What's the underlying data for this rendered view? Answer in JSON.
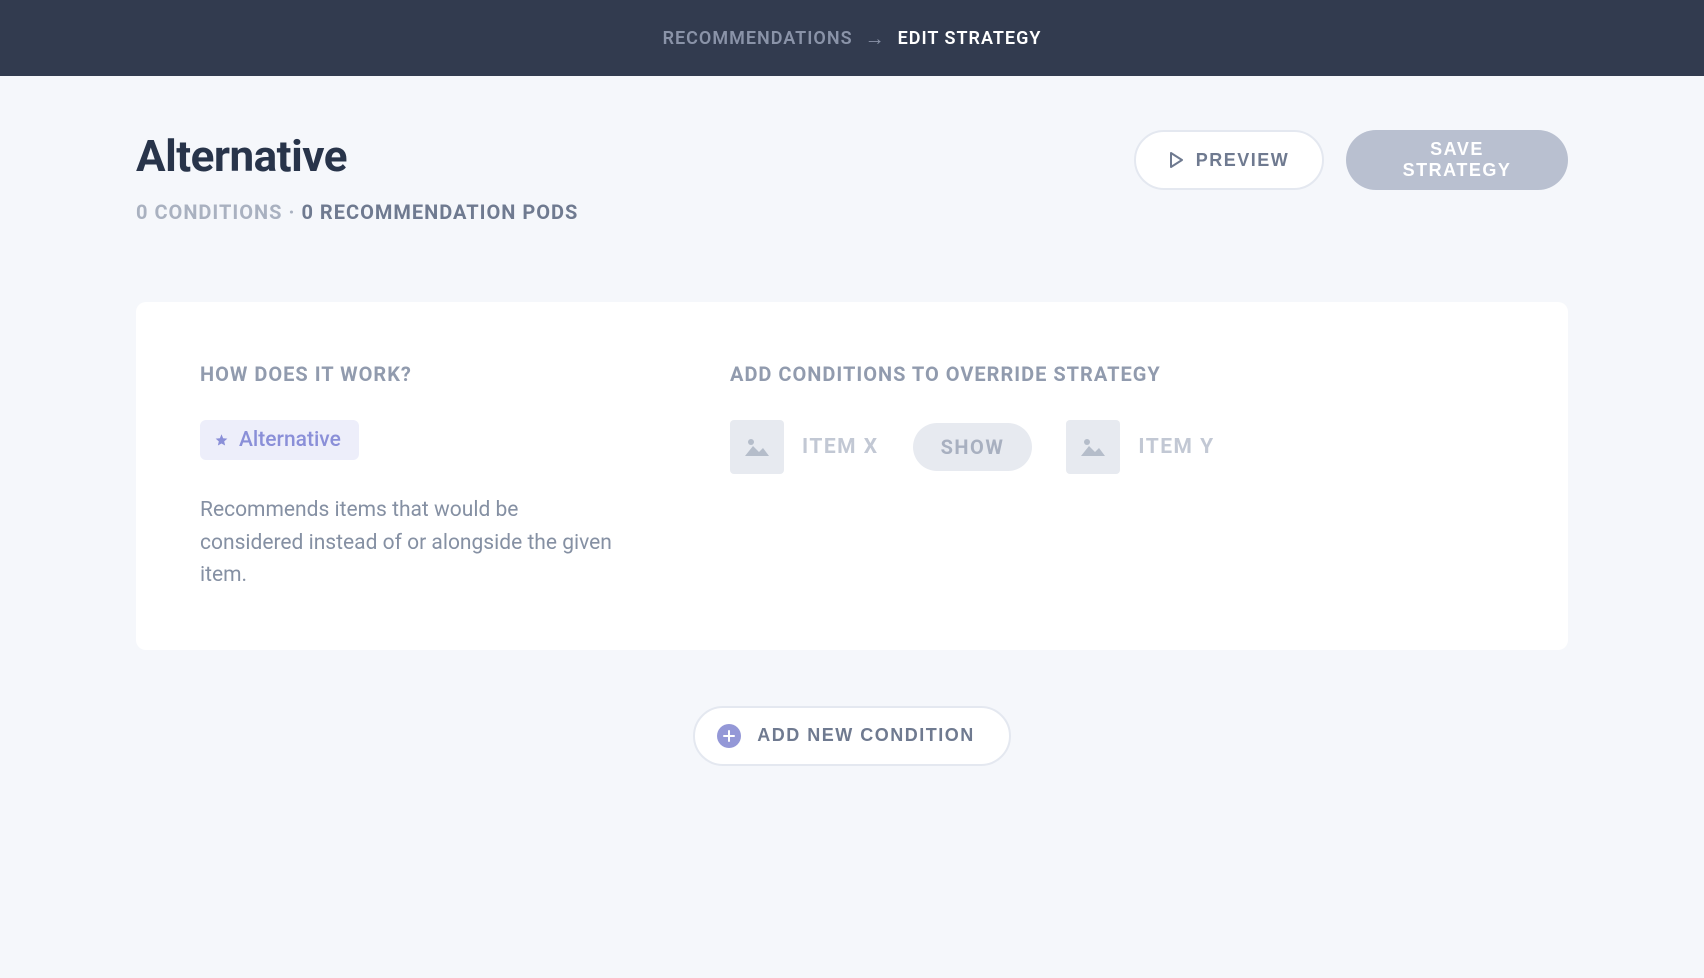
{
  "breadcrumb": {
    "parent": "Recommendations",
    "current": "Edit Strategy"
  },
  "title": "Alternative",
  "subtitle": {
    "conditions": "0 Conditions",
    "separator": "·",
    "pods": "0 Recommendation Pods"
  },
  "actions": {
    "preview": "Preview",
    "save": "Save Strategy"
  },
  "how_it_works": {
    "heading": "How does it work?",
    "tag": "Alternative",
    "description": "Recommends items that would be considered instead of or alongside the given item."
  },
  "conditions": {
    "heading": "Add conditions to override strategy",
    "item_x": "Item X",
    "show": "Show",
    "item_y": "Item Y"
  },
  "add_condition": "Add New Condition"
}
